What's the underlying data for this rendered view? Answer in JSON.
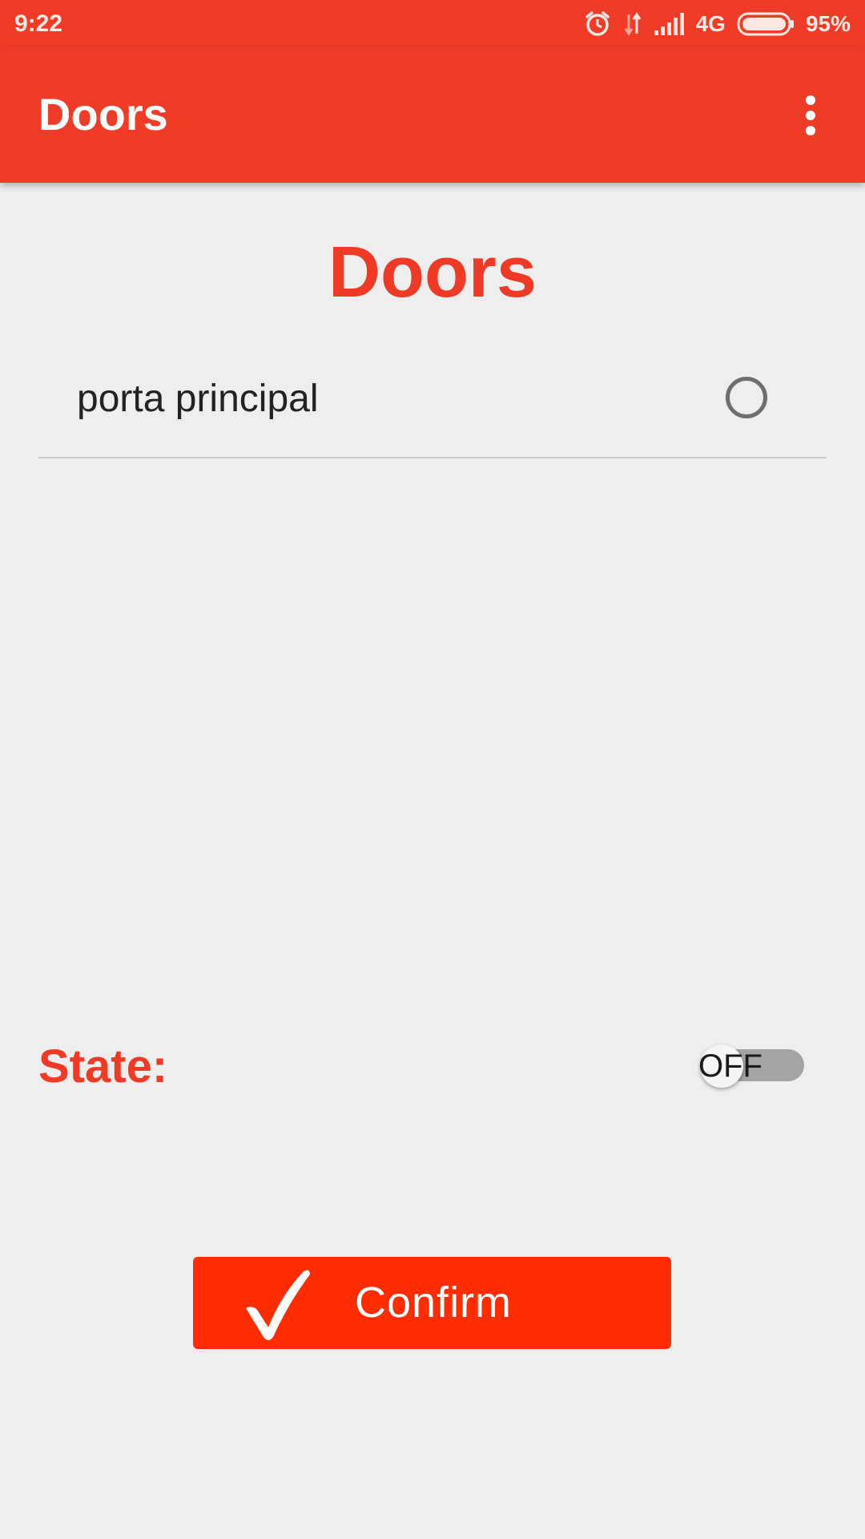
{
  "status_bar": {
    "time": "9:22",
    "network": "4G",
    "battery": "95%",
    "icons": [
      "alarm-icon",
      "data-arrows-icon",
      "signal-icon",
      "battery-icon"
    ]
  },
  "app_bar": {
    "title": "Doors",
    "menu_icon": "more-vert-icon"
  },
  "main": {
    "heading": "Doors",
    "doors": [
      {
        "label": "porta principal",
        "selected": false
      }
    ],
    "state_label": "State:",
    "toggle": {
      "text": "OFF",
      "checked": false
    },
    "confirm_button": {
      "label": "Confirm",
      "icon": "checkmark-icon"
    }
  },
  "colors": {
    "primary": "#f03c27",
    "accent_text": "#ef3a26",
    "button": "#ff2c00",
    "background": "#eeeeee"
  }
}
